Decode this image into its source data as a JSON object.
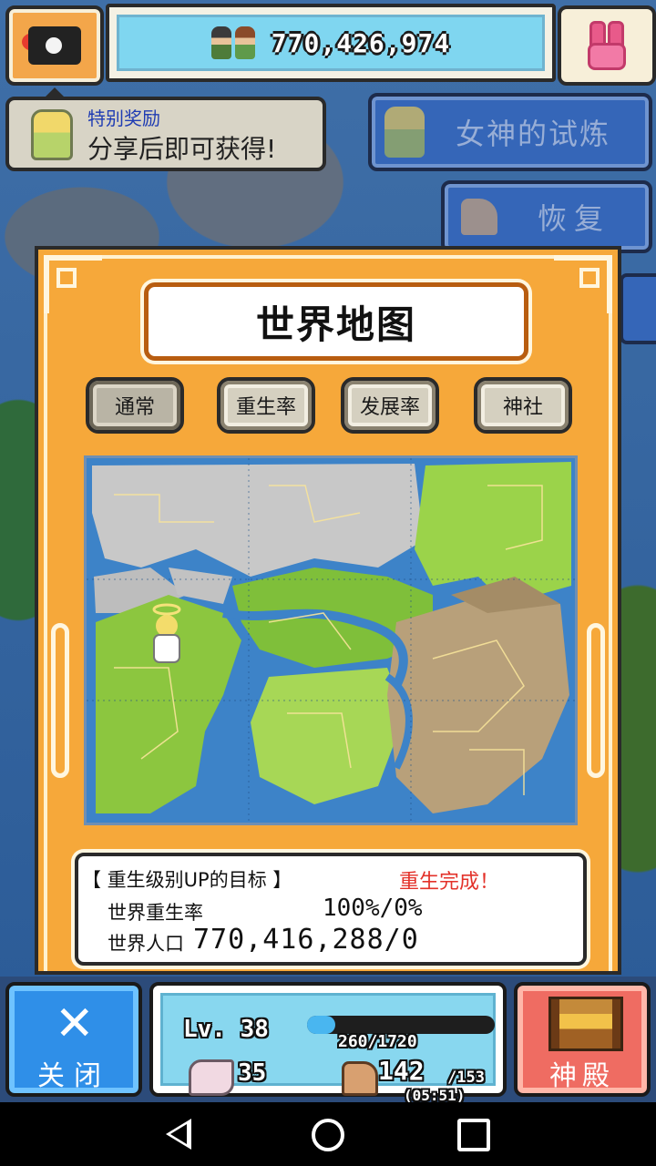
{
  "top_bar": {
    "population": "770,426,974",
    "camera_icon": "camera-icon",
    "goddess_icon": "bunny-goddess-icon"
  },
  "reward": {
    "title": "特别奖励",
    "text": "分享后即可获得!"
  },
  "side_menu": {
    "trial": "女神的试炼",
    "restore": "恢复",
    "trial_icon": "goddess-portrait-icon",
    "restore_icon": "muscle-arm-icon"
  },
  "panel": {
    "title": "世界地图",
    "tabs": [
      {
        "label": "通常",
        "active": true
      },
      {
        "label": "重生率",
        "active": false
      },
      {
        "label": "发展率",
        "active": false
      },
      {
        "label": "神社",
        "active": false
      }
    ]
  },
  "info": {
    "header": "【 重生级别UP的目标 】",
    "status": "重生完成！",
    "rebirth_label": "世界重生率",
    "rebirth_value": "100%/0%",
    "population_label": "世界人口",
    "population_value": "770,416,288/0"
  },
  "bottom": {
    "close_label": "关闭",
    "level": "Lv. 38",
    "exp": "260/1720",
    "exp_current": 260,
    "exp_max": 1720,
    "power": "35",
    "stamina": "142",
    "stamina_max": "/153",
    "timer": "(05:51)",
    "shrine_label": "神殿"
  },
  "colors": {
    "panel_orange": "#f6a83a",
    "close_blue": "#2f8fe8",
    "shrine_red": "#ef6c62",
    "status_text_red": "#e3322a"
  }
}
